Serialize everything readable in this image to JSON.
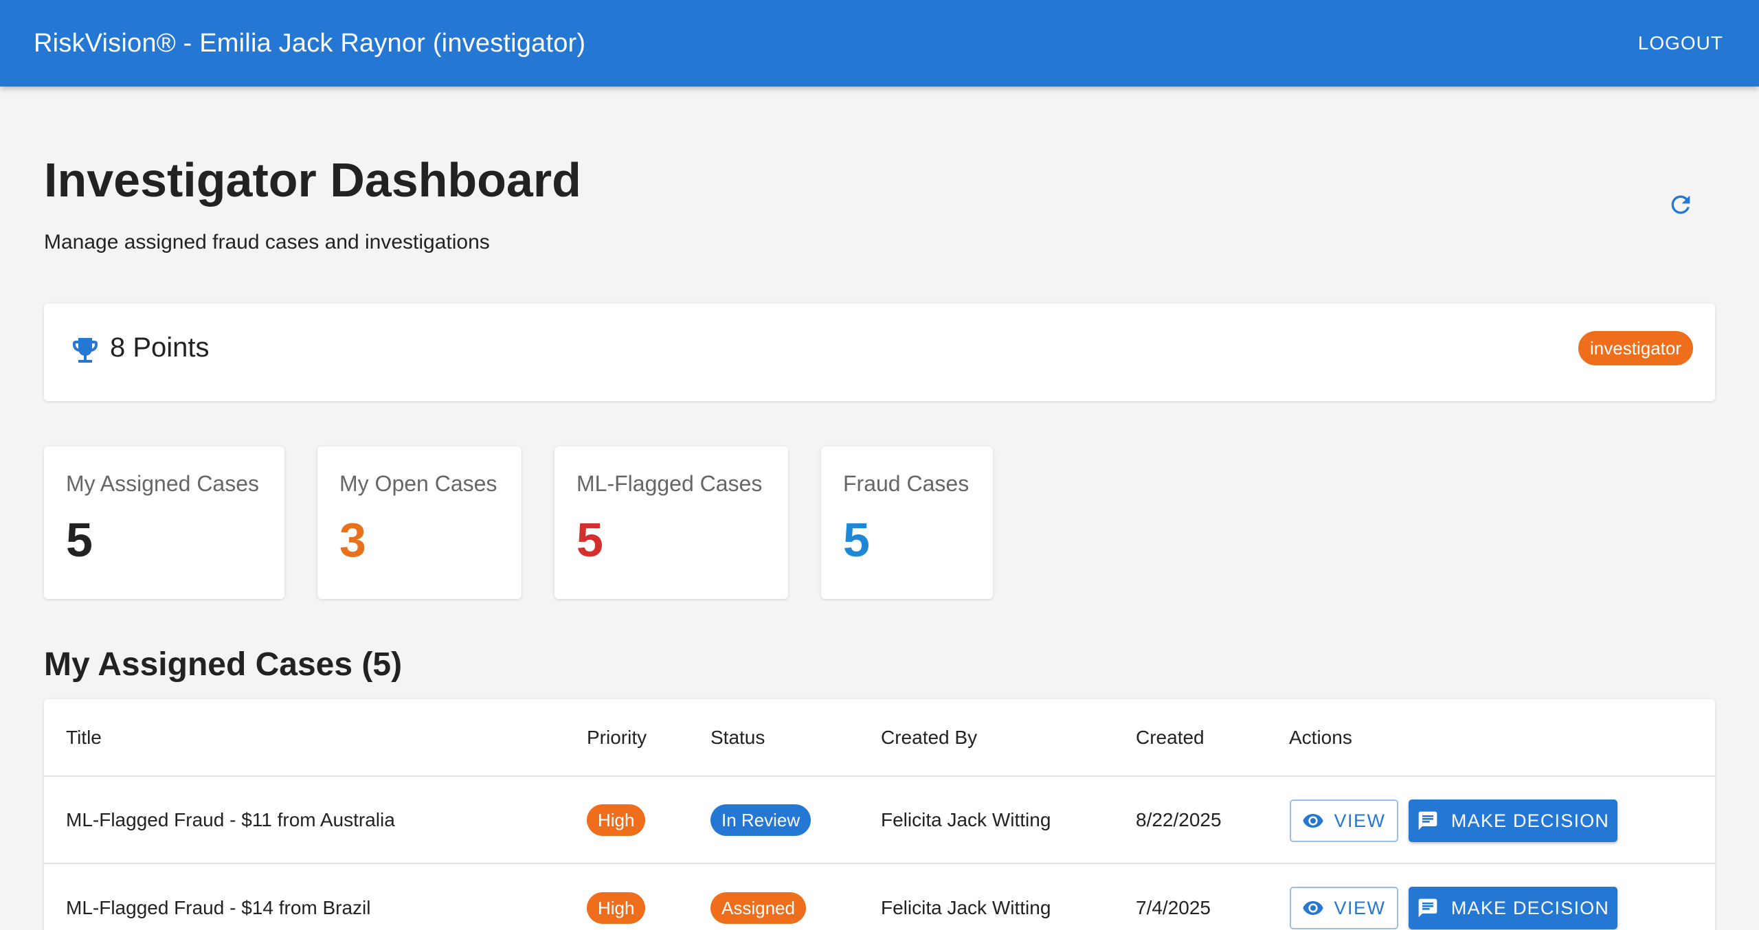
{
  "header": {
    "title": "RiskVision® - Emilia Jack Raynor (investigator)",
    "logout_label": "LOGOUT"
  },
  "page": {
    "title": "Investigator Dashboard",
    "subtitle": "Manage assigned fraud cases and investigations",
    "refresh_icon": "refresh-icon"
  },
  "points": {
    "icon": "trophy-icon",
    "text": "8 Points",
    "role_chip": "investigator"
  },
  "stats": [
    {
      "label": "My Assigned Cases",
      "value": "5",
      "color": "#222222"
    },
    {
      "label": "My Open Cases",
      "value": "3",
      "color": "#e8711e"
    },
    {
      "label": "ML-Flagged Cases",
      "value": "5",
      "color": "#d32f2f"
    },
    {
      "label": "Fraud Cases",
      "value": "5",
      "color": "#1e88d6"
    }
  ],
  "cases": {
    "section_title": "My Assigned Cases (5)",
    "columns": [
      "Title",
      "Priority",
      "Status",
      "Created By",
      "Created",
      "Actions"
    ],
    "view_label": "VIEW",
    "decision_label": "MAKE DECISION",
    "rows": [
      {
        "title": "ML-Flagged Fraud - $11 from Australia",
        "priority": "High",
        "status": "In Review",
        "created_by": "Felicita Jack Witting",
        "created": "8/22/2025"
      },
      {
        "title": "ML-Flagged Fraud - $14 from Brazil",
        "priority": "High",
        "status": "Assigned",
        "created_by": "Felicita Jack Witting",
        "created": "7/4/2025"
      }
    ]
  },
  "colors": {
    "appbar": "#2477d2",
    "priority_high": "#ee6e1c",
    "status_in_review": "#2477d2",
    "status_assigned": "#ee6e1c"
  }
}
